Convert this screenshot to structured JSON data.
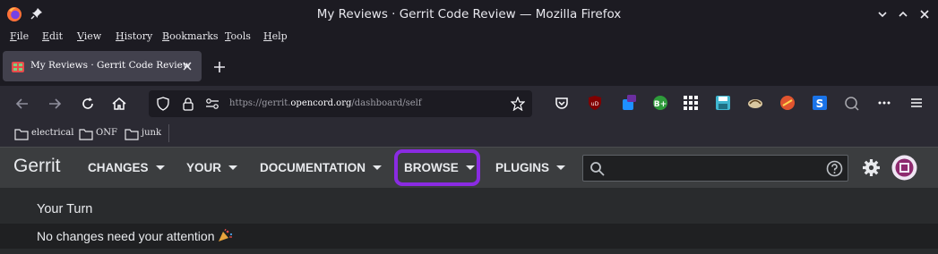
{
  "window": {
    "title": "My Reviews · Gerrit Code Review — Mozilla Firefox"
  },
  "menu": [
    "File",
    "Edit",
    "View",
    "History",
    "Bookmarks",
    "Tools",
    "Help"
  ],
  "tab": {
    "title": "My Reviews · Gerrit Code Review"
  },
  "navbar": {
    "url_scheme": "https://",
    "url_host_pre": "gerrit.",
    "url_host": "opencord.org",
    "url_path": "/dashboard/self"
  },
  "bookmarks": [
    "electrical",
    "ONF",
    "junk"
  ],
  "gerrit": {
    "title": "Gerrit",
    "nav": [
      "CHANGES",
      "YOUR",
      "DOCUMENTATION",
      "BROWSE",
      "PLUGINS"
    ],
    "search_placeholder": "",
    "highlight_color": "#8a2be2"
  },
  "dashboard": {
    "section_title": "Your Turn",
    "empty_message": "No changes need your attention"
  },
  "icons": {
    "titlebar": [
      "firefox-logo-icon",
      "pin-icon",
      "chevron-down-icon",
      "minimize-icon",
      "close-icon"
    ],
    "navbar": [
      "back-icon",
      "forward-icon",
      "reload-icon",
      "home-icon",
      "shield-icon",
      "lock-icon",
      "permissions-icon",
      "bookmark-star-icon"
    ],
    "extensions": [
      "pocket-icon",
      "ublock-icon",
      "extension-icon",
      "extension-icon",
      "extension-icon",
      "grid-icon",
      "save-icon",
      "extension-icon",
      "extension-icon",
      "extension-icon",
      "extension-icon",
      "overflow-icon",
      "menu-icon"
    ]
  }
}
